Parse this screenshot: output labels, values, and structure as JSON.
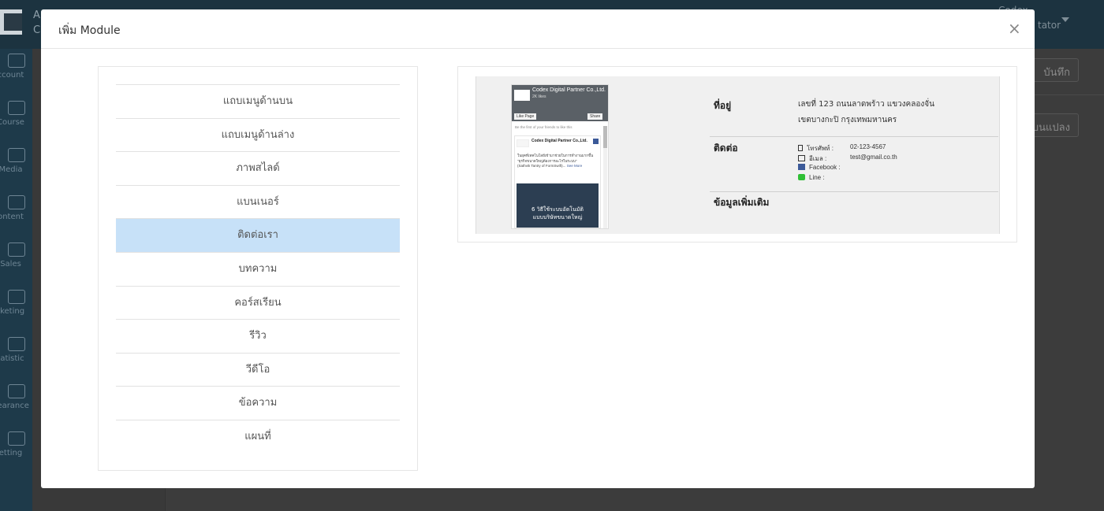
{
  "background_app": {
    "brand_line1": "A",
    "brand_line2": "C",
    "user_name": "Codex",
    "user_role": "tator",
    "sidebar": [
      {
        "label": "ccount",
        "icon": "users-icon"
      },
      {
        "label": "Course",
        "icon": "books-icon"
      },
      {
        "label": "Media",
        "icon": "play-icon"
      },
      {
        "label": "ontent",
        "icon": "edit-icon"
      },
      {
        "label": "Sales",
        "icon": "basket-icon"
      },
      {
        "label": "rketing",
        "icon": "dollar-icon"
      },
      {
        "label": "tatistic",
        "icon": "chart-icon"
      },
      {
        "label": "pearance",
        "icon": "monitor-gear-icon"
      },
      {
        "label": "etting",
        "icon": "gears-icon"
      }
    ],
    "save_button": "บันทึก",
    "edit_button": "บนแปลง"
  },
  "modal": {
    "title": "เพิ่ม Module",
    "close": "×",
    "menu": [
      {
        "label": "แถบเมนูด้านบน",
        "active": false
      },
      {
        "label": "แถบเมนูด้านล่าง",
        "active": false
      },
      {
        "label": "ภาพสไลด์",
        "active": false
      },
      {
        "label": "แบนเนอร์",
        "active": false
      },
      {
        "label": "ติดต่อเรา",
        "active": true
      },
      {
        "label": "บทความ",
        "active": false
      },
      {
        "label": "คอร์สเรียน",
        "active": false
      },
      {
        "label": "รีวิว",
        "active": false
      },
      {
        "label": "วีดีโอ",
        "active": false
      },
      {
        "label": "ข้อความ",
        "active": false
      },
      {
        "label": "แผนที่",
        "active": false
      }
    ],
    "preview": {
      "facebook": {
        "page_name": "Codex Digital Partner Co.,Ltd.",
        "likes": "2K likes",
        "like_button": "Like Page",
        "share_button": "Share",
        "friends_text": "Be the first of your friends to like this",
        "post_name": "Codex Digital Partner Co.,Ltd.",
        "post_text_1": "ในยุคที่เทคโนโลยีเข้ามาช่วยในการทำงานมากขึ้น",
        "post_text_2": "\"ธุรกิจขนาดใหญ่ต้องการอะไรในระบบ\"",
        "post_text_3": "(Sathvik Tantry of FormSwift)...",
        "see_more": "See More",
        "image_caption_1": "6 วิธีใช้ระบบอัตโนมัติ",
        "image_caption_2": "แบบบริษัทขนาดใหญ่"
      },
      "address_label": "ที่อยู่",
      "address_line1": "เลขที่ 123 ถนนลาดพร้าว แขวงคลองจั่น",
      "address_line2": "เขตบางกะปิ กรุงเทพมหานคร",
      "contact_label": "ติดต่อ",
      "contacts": [
        {
          "icon": "phone-icon",
          "label": "โทรศัพท์ :",
          "value": "02-123-4567"
        },
        {
          "icon": "mail-icon",
          "label": "อีเมล :",
          "value": "test@gmail.co.th"
        },
        {
          "icon": "facebook-icon",
          "label": "Facebook :",
          "value": ""
        },
        {
          "icon": "line-icon",
          "label": "Line :",
          "value": ""
        }
      ],
      "more_info_label": "ข้อมูลเพิ่มเติม"
    }
  }
}
